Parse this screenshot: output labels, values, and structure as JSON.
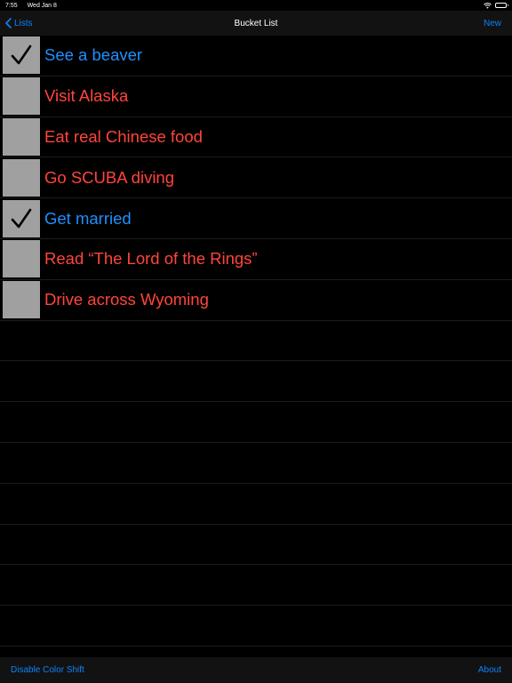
{
  "status_bar": {
    "time": "7:55",
    "date": "Wed Jan 8"
  },
  "nav": {
    "back_label": "Lists",
    "title": "Bucket List",
    "new_label": "New"
  },
  "items": [
    {
      "label": "See a beaver",
      "checked": true
    },
    {
      "label": "Visit Alaska",
      "checked": false
    },
    {
      "label": "Eat real Chinese food",
      "checked": false
    },
    {
      "label": "Go SCUBA diving",
      "checked": false
    },
    {
      "label": "Get married",
      "checked": true
    },
    {
      "label": "Read “The Lord of the Rings”",
      "checked": false
    },
    {
      "label": "Drive across Wyoming",
      "checked": false
    }
  ],
  "empty_row_count": 8,
  "toolbar": {
    "left_label": "Disable Color Shift",
    "right_label": "About"
  },
  "colors": {
    "accent": "#0a84ff",
    "done_text": "#1e90ff",
    "todo_text": "#ff453a",
    "checkbox": "#a0a0a0",
    "background": "#000000"
  },
  "icons": {
    "back": "chevron-left-icon",
    "check": "checkmark-icon",
    "wifi": "wifi-icon",
    "battery": "battery-icon"
  }
}
